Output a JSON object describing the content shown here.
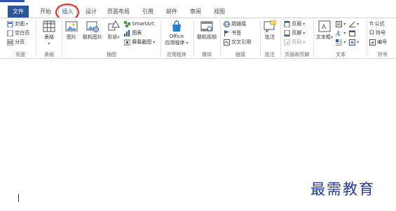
{
  "tabs": {
    "file": "文件",
    "home": "开始",
    "insert": "插入",
    "design": "设计",
    "layout": "页面布局",
    "references": "引用",
    "mailings": "邮件",
    "review": "审阅",
    "view": "视图"
  },
  "pages_group": {
    "cover": "封面",
    "blank": "空白页",
    "break": "分页",
    "label": "页面"
  },
  "table_group": {
    "table": "表格",
    "label": "表格"
  },
  "illustrations_group": {
    "pictures": "图片",
    "online_pictures": "联机图片",
    "shapes": "形状",
    "smartart": "SmartArt",
    "chart": "图表",
    "screenshot": "屏幕截图",
    "label": "插图"
  },
  "apps_group": {
    "office_line1": "Office",
    "office_line2": "应用程序",
    "label": "应用程序"
  },
  "media_group": {
    "online_video": "联机视频",
    "label": "媒体"
  },
  "links_group": {
    "hyperlink": "超链接",
    "bookmark": "书签",
    "cross_ref": "交叉引用",
    "label": "链接"
  },
  "comments_group": {
    "comment": "批注",
    "label": "批注"
  },
  "header_footer_group": {
    "header": "页眉",
    "footer": "页脚",
    "page_number": "页码",
    "label": "页眉和页脚"
  },
  "text_group": {
    "textbox": "文本框",
    "label": "文本"
  },
  "symbols_group": {
    "equation": "公式",
    "symbol": "符号",
    "number": "编号",
    "label": "符号"
  },
  "watermark": "最需教育",
  "colors": {
    "accent": "#2b579a",
    "highlight_circle": "#e8232a",
    "watermark": "#243a8f"
  }
}
